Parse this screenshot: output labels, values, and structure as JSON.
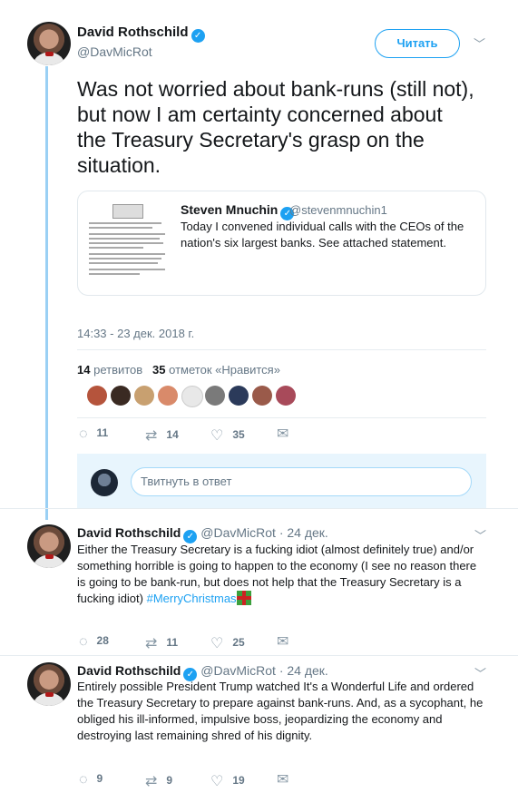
{
  "main_tweet": {
    "author_name": "David Rothschild",
    "author_handle": "@DavMicRot",
    "follow_label": "Читать",
    "text": "Was not worried about bank-runs (still not), but now I am certainty concerned about the Treasury Secretary's grasp on the situation.",
    "quote": {
      "author_name": "Steven Mnuchin",
      "author_handle": "@stevenmnuchin1",
      "text": "Today I convened individual calls with the CEOs of the nation's six largest banks. See attached statement."
    },
    "timestamp": "14:33 - 23 дек. 2018 г.",
    "retweets_count": "14",
    "retweets_label": "ретвитов",
    "likes_count": "35",
    "likes_label": "отметок «Нравится»",
    "actions": {
      "replies": "11",
      "retweets": "14",
      "likes": "35"
    }
  },
  "reply_box": {
    "placeholder": "Твитнуть в ответ"
  },
  "replies": [
    {
      "author_name": "David Rothschild",
      "author_handle": "@DavMicRot",
      "date": "· 24 дек.",
      "text": "Either the Treasury Secretary is a fucking idiot (almost definitely true) and/or something horrible is going to happen to the economy (I see no reason there is going to be bank-run, but does not help that the Treasury Secretary is a fucking idiot) ",
      "hashtag": "#MerryChristmas",
      "actions": {
        "replies": "28",
        "retweets": "11",
        "likes": "25"
      }
    },
    {
      "author_name": "David Rothschild",
      "author_handle": "@DavMicRot",
      "date": "· 24 дек.",
      "text": "Entirely possible President Trump watched It's a Wonderful Life and ordered the Treasury Secretary to prepare against bank-runs. And, as a sycophant, he obliged his ill-informed, impulsive boss, jeopardizing the economy and destroying last remaining shred of his dignity.",
      "actions": {
        "replies": "9",
        "retweets": "9",
        "likes": "19"
      }
    }
  ],
  "icons": {
    "reply": "reply-icon",
    "retweet": "retweet-icon",
    "like": "heart-icon",
    "dm": "envelope-icon",
    "verified": "verified-badge-icon",
    "caret": "chevron-down-icon"
  }
}
